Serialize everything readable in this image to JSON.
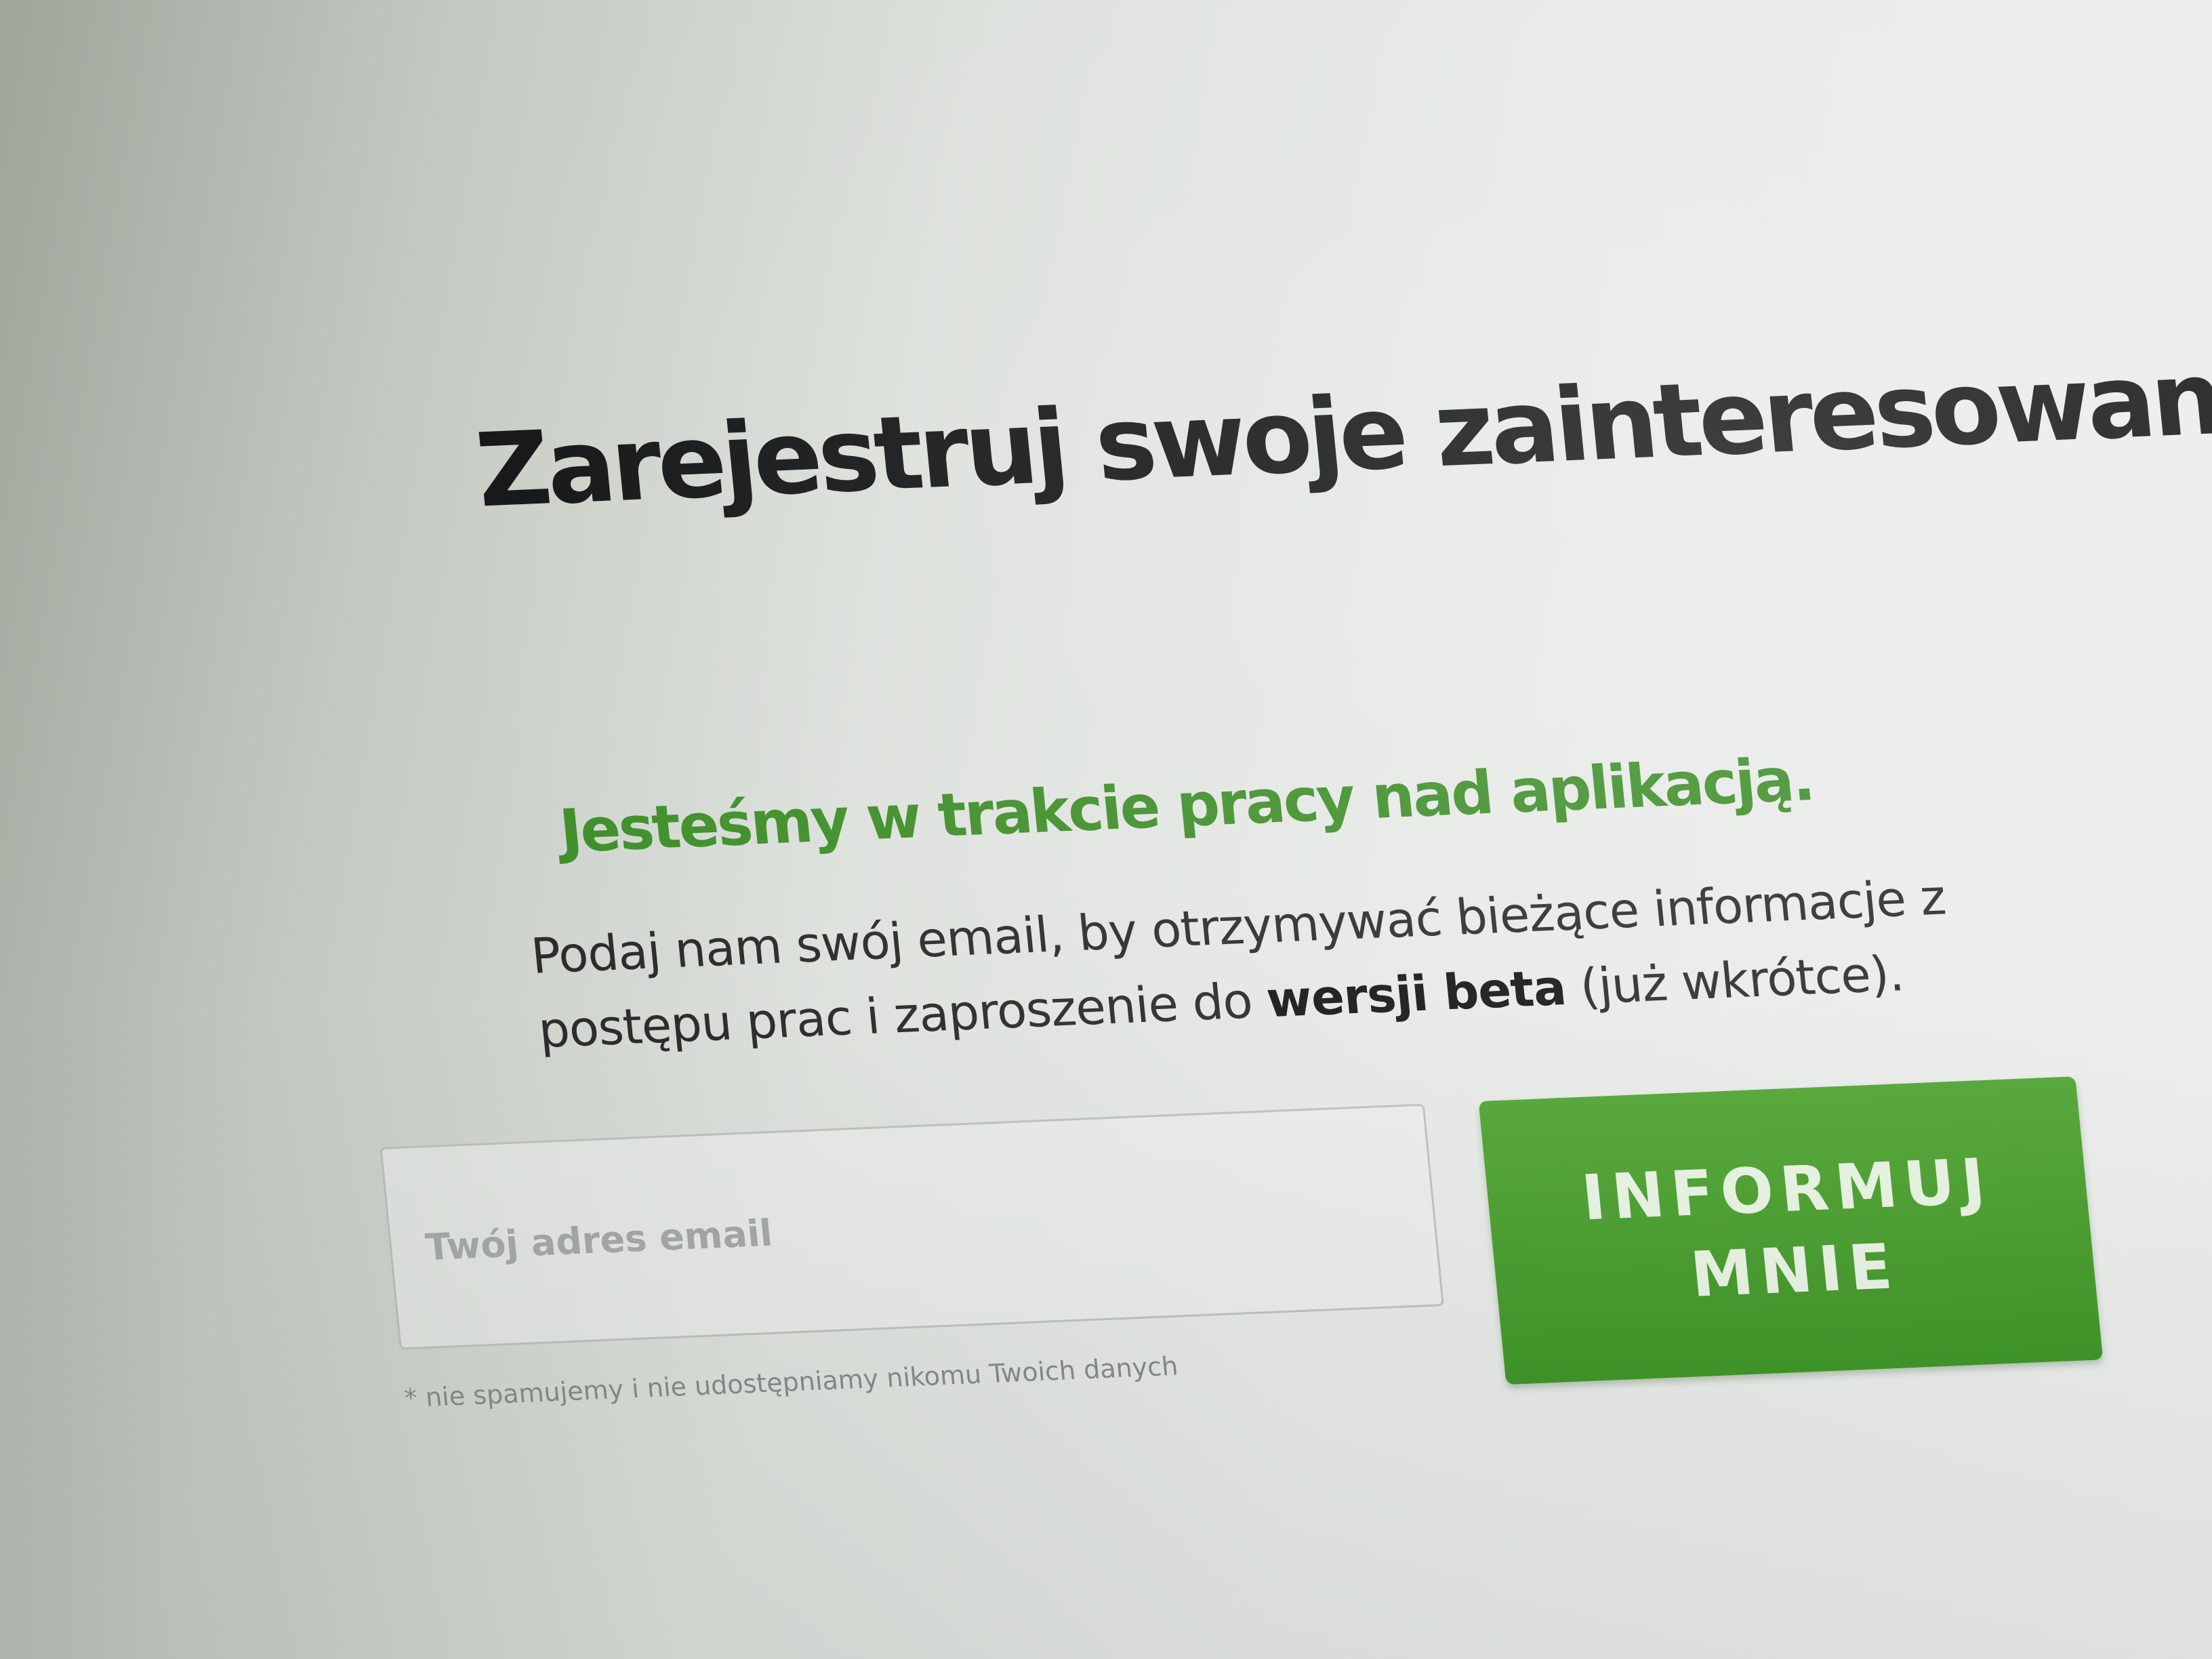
{
  "page": {
    "title": "Zarejestruj swoje zainteresowanie",
    "subtitle": "Jesteśmy w trakcie pracy nad aplikacją.",
    "description": {
      "part1": "Podaj nam swój email, by otrzymywać bieżące informacje z postępu prac i zaproszenie do ",
      "bold": "wersji beta",
      "part2": " (już wkrótce)."
    }
  },
  "form": {
    "email_placeholder": "Twój adres email",
    "email_value": "",
    "note": "* nie spamujemy i nie udostępniamy nikomu Twoich danych",
    "submit_line1": "INFORMUJ",
    "submit_line2": "MNIE"
  },
  "colors": {
    "accent_green": "#3f8f2a",
    "button_green": "#46a02d",
    "title_text": "#151618"
  }
}
